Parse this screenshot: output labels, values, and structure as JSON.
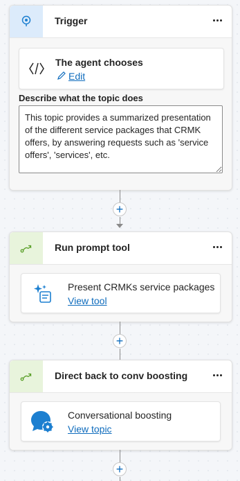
{
  "trigger": {
    "title": "Trigger",
    "card_title": "The agent chooses",
    "edit_label": "Edit",
    "describe_label": "Describe what the topic does",
    "description": "This topic provides a summarized presentation of the different service packages that CRMK offers, by answering requests such as 'service offers', 'services', etc."
  },
  "node2": {
    "title": "Run prompt tool",
    "card_title": "Present CRMKs service packages",
    "link": "View tool"
  },
  "node3": {
    "title": "Direct back to conv boosting",
    "card_title": "Conversational boosting",
    "link": "View topic"
  },
  "connectors": {
    "add_symbol": "+"
  },
  "colors": {
    "trigger_icon_bg": "#dcebfb",
    "action_icon_bg": "#e8f4dc",
    "link": "#0f6cbd",
    "accent_blue": "#1c7fd0",
    "accent_green": "#5ba02a"
  },
  "icons": {
    "trigger": "trigger-pin-icon",
    "action": "redirect-arrow-icon",
    "agent": "code-brackets-icon",
    "edit": "pencil-icon",
    "prompt": "sparkle-document-icon",
    "conversational": "chat-gear-icon",
    "more": "more-horizontal-icon"
  }
}
